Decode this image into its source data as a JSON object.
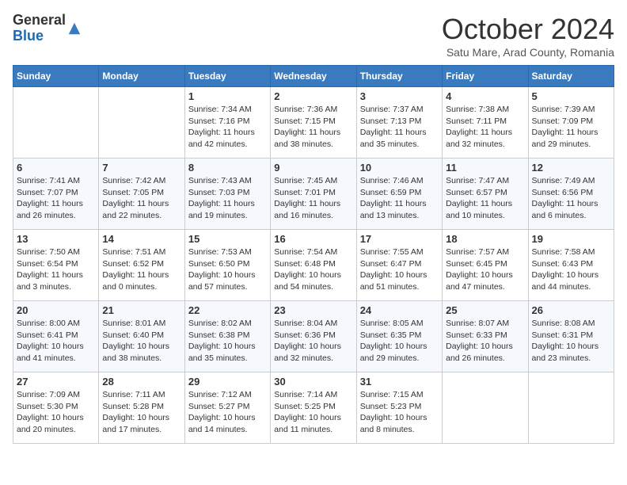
{
  "header": {
    "logo": {
      "general": "General",
      "blue": "Blue"
    },
    "title": "October 2024",
    "location": "Satu Mare, Arad County, Romania"
  },
  "weekdays": [
    "Sunday",
    "Monday",
    "Tuesday",
    "Wednesday",
    "Thursday",
    "Friday",
    "Saturday"
  ],
  "weeks": [
    [
      {
        "day": "",
        "sunrise": "",
        "sunset": "",
        "daylight": ""
      },
      {
        "day": "",
        "sunrise": "",
        "sunset": "",
        "daylight": ""
      },
      {
        "day": "1",
        "sunrise": "Sunrise: 7:34 AM",
        "sunset": "Sunset: 7:16 PM",
        "daylight": "Daylight: 11 hours and 42 minutes."
      },
      {
        "day": "2",
        "sunrise": "Sunrise: 7:36 AM",
        "sunset": "Sunset: 7:15 PM",
        "daylight": "Daylight: 11 hours and 38 minutes."
      },
      {
        "day": "3",
        "sunrise": "Sunrise: 7:37 AM",
        "sunset": "Sunset: 7:13 PM",
        "daylight": "Daylight: 11 hours and 35 minutes."
      },
      {
        "day": "4",
        "sunrise": "Sunrise: 7:38 AM",
        "sunset": "Sunset: 7:11 PM",
        "daylight": "Daylight: 11 hours and 32 minutes."
      },
      {
        "day": "5",
        "sunrise": "Sunrise: 7:39 AM",
        "sunset": "Sunset: 7:09 PM",
        "daylight": "Daylight: 11 hours and 29 minutes."
      }
    ],
    [
      {
        "day": "6",
        "sunrise": "Sunrise: 7:41 AM",
        "sunset": "Sunset: 7:07 PM",
        "daylight": "Daylight: 11 hours and 26 minutes."
      },
      {
        "day": "7",
        "sunrise": "Sunrise: 7:42 AM",
        "sunset": "Sunset: 7:05 PM",
        "daylight": "Daylight: 11 hours and 22 minutes."
      },
      {
        "day": "8",
        "sunrise": "Sunrise: 7:43 AM",
        "sunset": "Sunset: 7:03 PM",
        "daylight": "Daylight: 11 hours and 19 minutes."
      },
      {
        "day": "9",
        "sunrise": "Sunrise: 7:45 AM",
        "sunset": "Sunset: 7:01 PM",
        "daylight": "Daylight: 11 hours and 16 minutes."
      },
      {
        "day": "10",
        "sunrise": "Sunrise: 7:46 AM",
        "sunset": "Sunset: 6:59 PM",
        "daylight": "Daylight: 11 hours and 13 minutes."
      },
      {
        "day": "11",
        "sunrise": "Sunrise: 7:47 AM",
        "sunset": "Sunset: 6:57 PM",
        "daylight": "Daylight: 11 hours and 10 minutes."
      },
      {
        "day": "12",
        "sunrise": "Sunrise: 7:49 AM",
        "sunset": "Sunset: 6:56 PM",
        "daylight": "Daylight: 11 hours and 6 minutes."
      }
    ],
    [
      {
        "day": "13",
        "sunrise": "Sunrise: 7:50 AM",
        "sunset": "Sunset: 6:54 PM",
        "daylight": "Daylight: 11 hours and 3 minutes."
      },
      {
        "day": "14",
        "sunrise": "Sunrise: 7:51 AM",
        "sunset": "Sunset: 6:52 PM",
        "daylight": "Daylight: 11 hours and 0 minutes."
      },
      {
        "day": "15",
        "sunrise": "Sunrise: 7:53 AM",
        "sunset": "Sunset: 6:50 PM",
        "daylight": "Daylight: 10 hours and 57 minutes."
      },
      {
        "day": "16",
        "sunrise": "Sunrise: 7:54 AM",
        "sunset": "Sunset: 6:48 PM",
        "daylight": "Daylight: 10 hours and 54 minutes."
      },
      {
        "day": "17",
        "sunrise": "Sunrise: 7:55 AM",
        "sunset": "Sunset: 6:47 PM",
        "daylight": "Daylight: 10 hours and 51 minutes."
      },
      {
        "day": "18",
        "sunrise": "Sunrise: 7:57 AM",
        "sunset": "Sunset: 6:45 PM",
        "daylight": "Daylight: 10 hours and 47 minutes."
      },
      {
        "day": "19",
        "sunrise": "Sunrise: 7:58 AM",
        "sunset": "Sunset: 6:43 PM",
        "daylight": "Daylight: 10 hours and 44 minutes."
      }
    ],
    [
      {
        "day": "20",
        "sunrise": "Sunrise: 8:00 AM",
        "sunset": "Sunset: 6:41 PM",
        "daylight": "Daylight: 10 hours and 41 minutes."
      },
      {
        "day": "21",
        "sunrise": "Sunrise: 8:01 AM",
        "sunset": "Sunset: 6:40 PM",
        "daylight": "Daylight: 10 hours and 38 minutes."
      },
      {
        "day": "22",
        "sunrise": "Sunrise: 8:02 AM",
        "sunset": "Sunset: 6:38 PM",
        "daylight": "Daylight: 10 hours and 35 minutes."
      },
      {
        "day": "23",
        "sunrise": "Sunrise: 8:04 AM",
        "sunset": "Sunset: 6:36 PM",
        "daylight": "Daylight: 10 hours and 32 minutes."
      },
      {
        "day": "24",
        "sunrise": "Sunrise: 8:05 AM",
        "sunset": "Sunset: 6:35 PM",
        "daylight": "Daylight: 10 hours and 29 minutes."
      },
      {
        "day": "25",
        "sunrise": "Sunrise: 8:07 AM",
        "sunset": "Sunset: 6:33 PM",
        "daylight": "Daylight: 10 hours and 26 minutes."
      },
      {
        "day": "26",
        "sunrise": "Sunrise: 8:08 AM",
        "sunset": "Sunset: 6:31 PM",
        "daylight": "Daylight: 10 hours and 23 minutes."
      }
    ],
    [
      {
        "day": "27",
        "sunrise": "Sunrise: 7:09 AM",
        "sunset": "Sunset: 5:30 PM",
        "daylight": "Daylight: 10 hours and 20 minutes."
      },
      {
        "day": "28",
        "sunrise": "Sunrise: 7:11 AM",
        "sunset": "Sunset: 5:28 PM",
        "daylight": "Daylight: 10 hours and 17 minutes."
      },
      {
        "day": "29",
        "sunrise": "Sunrise: 7:12 AM",
        "sunset": "Sunset: 5:27 PM",
        "daylight": "Daylight: 10 hours and 14 minutes."
      },
      {
        "day": "30",
        "sunrise": "Sunrise: 7:14 AM",
        "sunset": "Sunset: 5:25 PM",
        "daylight": "Daylight: 10 hours and 11 minutes."
      },
      {
        "day": "31",
        "sunrise": "Sunrise: 7:15 AM",
        "sunset": "Sunset: 5:23 PM",
        "daylight": "Daylight: 10 hours and 8 minutes."
      },
      {
        "day": "",
        "sunrise": "",
        "sunset": "",
        "daylight": ""
      },
      {
        "day": "",
        "sunrise": "",
        "sunset": "",
        "daylight": ""
      }
    ]
  ]
}
